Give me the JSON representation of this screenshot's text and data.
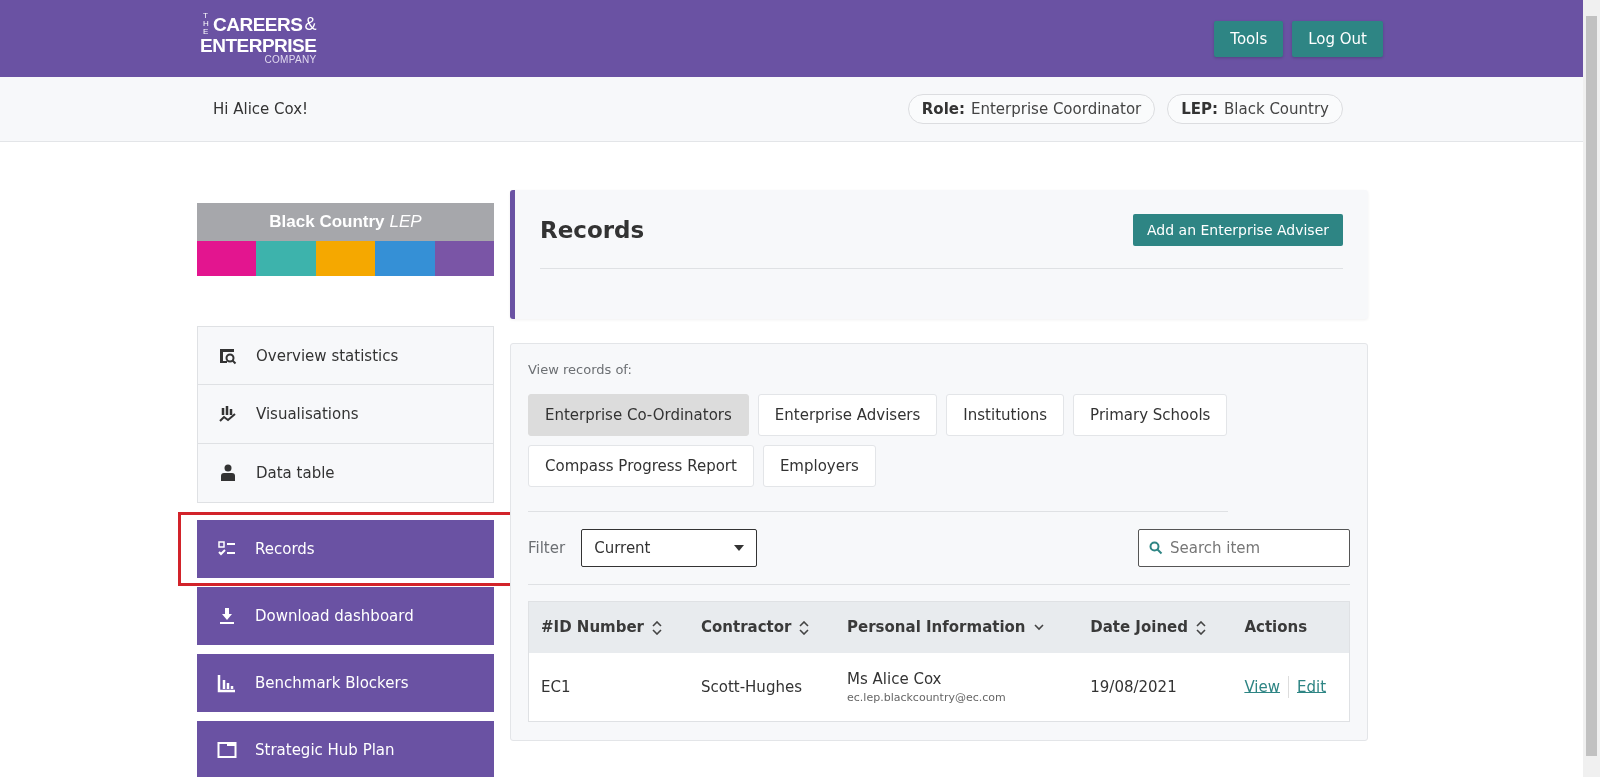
{
  "header": {
    "logo": {
      "prefix": "THE",
      "line_1": "CAREERS",
      "amp": "&",
      "line_2": "ENTERPRISE",
      "line_3": "COMPANY"
    },
    "buttons": [
      "Tools",
      "Log Out"
    ]
  },
  "subheader": {
    "greeting": "Hi Alice Cox!",
    "pills": [
      {
        "label": "Role:",
        "value": "Enterprise Coordinator"
      },
      {
        "label": "LEP:",
        "value": "Black Country"
      }
    ]
  },
  "sidebar": {
    "banner": {
      "title": "Black Country",
      "suffix": "LEP",
      "stripes": [
        {
          "color": "#e3158f"
        },
        {
          "color": "#3db3ac"
        },
        {
          "color": "#f5a800"
        },
        {
          "color": "#3590d6"
        },
        {
          "color": "#7a55a6"
        }
      ]
    },
    "items": [
      {
        "label": "Overview statistics",
        "kind": "link",
        "highlighted": false
      },
      {
        "label": "Visualisations",
        "kind": "link",
        "highlighted": false
      },
      {
        "label": "Data table",
        "kind": "link",
        "highlighted": false
      },
      {
        "label": "Records",
        "kind": "action",
        "highlighted": true
      },
      {
        "label": "Download dashboard",
        "kind": "action",
        "highlighted": false
      },
      {
        "label": "Benchmark Blockers",
        "kind": "action",
        "highlighted": false
      },
      {
        "label": "Strategic Hub Plan",
        "kind": "action",
        "highlighted": false
      }
    ]
  },
  "records": {
    "title": "Records",
    "add_button": "Add an Enterprise Adviser"
  },
  "panel": {
    "view_label": "View records of:",
    "tabs": [
      {
        "label": "Enterprise Co-Ordinators",
        "selected": true
      },
      {
        "label": "Enterprise Advisers",
        "selected": false
      },
      {
        "label": "Institutions",
        "selected": false
      },
      {
        "label": "Primary Schools",
        "selected": false
      },
      {
        "label": "Compass Progress Report",
        "selected": false
      },
      {
        "label": "Employers",
        "selected": false
      }
    ],
    "filter": {
      "label": "Filter",
      "value": "Current"
    },
    "search": {
      "placeholder": "Search item"
    },
    "table": {
      "columns": [
        {
          "label": "#ID Number"
        },
        {
          "label": "Contractor"
        },
        {
          "label": "Personal Information"
        },
        {
          "label": "Date Joined"
        },
        {
          "label": "Actions"
        }
      ],
      "rows": [
        {
          "id": "EC1",
          "contractor": "Scott-Hughes",
          "name": "Ms Alice Cox",
          "email": "ec.lep.blackcountry@ec.com",
          "date": "19/08/2021",
          "actions": [
            "View",
            "Edit"
          ]
        }
      ]
    }
  }
}
